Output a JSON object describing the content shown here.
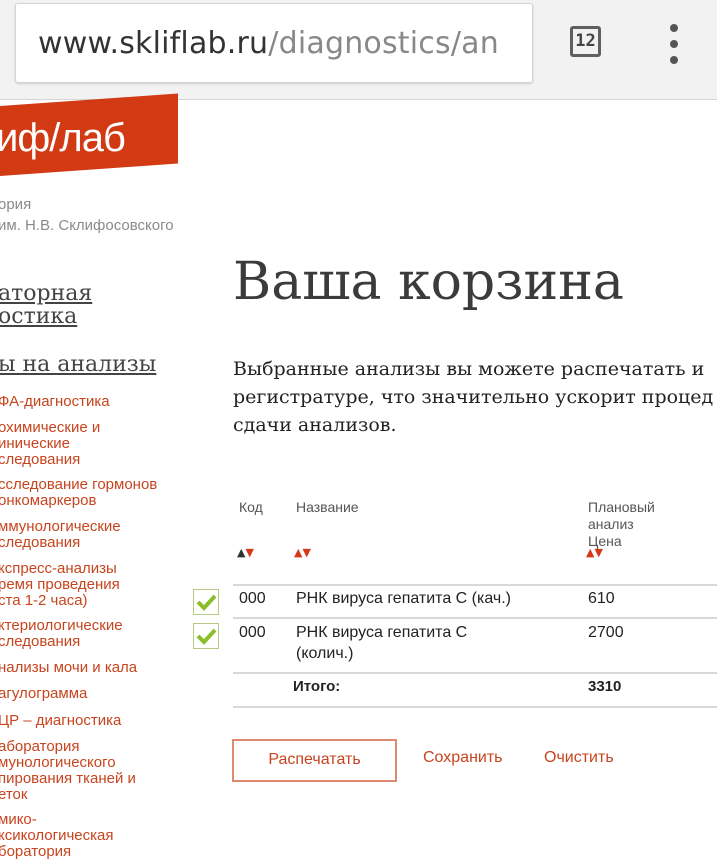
{
  "browser": {
    "url_host": "www.skliflab.ru",
    "url_path": "/diagnostics/an",
    "tab_count": "12"
  },
  "logo": {
    "text": "иф/лаб"
  },
  "subtitle": {
    "line1": "ория",
    "line2": "им. Н.В. Склифосовского"
  },
  "sidebar": {
    "heading_line1": "аторная",
    "heading_line2": "остика",
    "section": "ы на анализы",
    "links": [
      "ФА-диагностика",
      "охимические и\nинические\nследования",
      "сследование гормонов\nонкомаркеров",
      "ммунологические\nследования",
      "кспресс-анализы\nремя проведения\nста 1-2 часа)",
      "ктериологические\nследования",
      "нализы мочи и кала",
      "агулограмма",
      "ЦР – диагностика",
      "аборатория\nмунологического\nпирования тканей и\nеток",
      "мико-\nксикологическая\nборатория"
    ]
  },
  "main": {
    "title": "Ваша корзина",
    "intro_line1": "Выбранные анализы вы можете распечатать и",
    "intro_line2": "регистратуре, что значительно ускорит процед",
    "intro_line3": "сдачи анализов."
  },
  "table": {
    "headers": {
      "code": "Код",
      "name": "Название",
      "plan_line1": "Плановый",
      "plan_line2": "анализ",
      "plan_line3": "Цена"
    },
    "sort_icon": "▲▼",
    "rows": [
      {
        "code": "000",
        "name": "РНК вируса гепатита С (кач.)",
        "name2": "",
        "price": "610",
        "checked": true
      },
      {
        "code": "000",
        "name": "РНК вируса гепатита С",
        "name2": "(колич.)",
        "price": "2700",
        "checked": true
      }
    ],
    "total_label": "Итого:",
    "total_value": "3310"
  },
  "actions": {
    "print": "Распечатать",
    "save": "Сохранить",
    "clear": "Очистить"
  },
  "colors": {
    "brand": "#d23a14",
    "link": "#c8441e",
    "check": "#8bbf2a"
  }
}
